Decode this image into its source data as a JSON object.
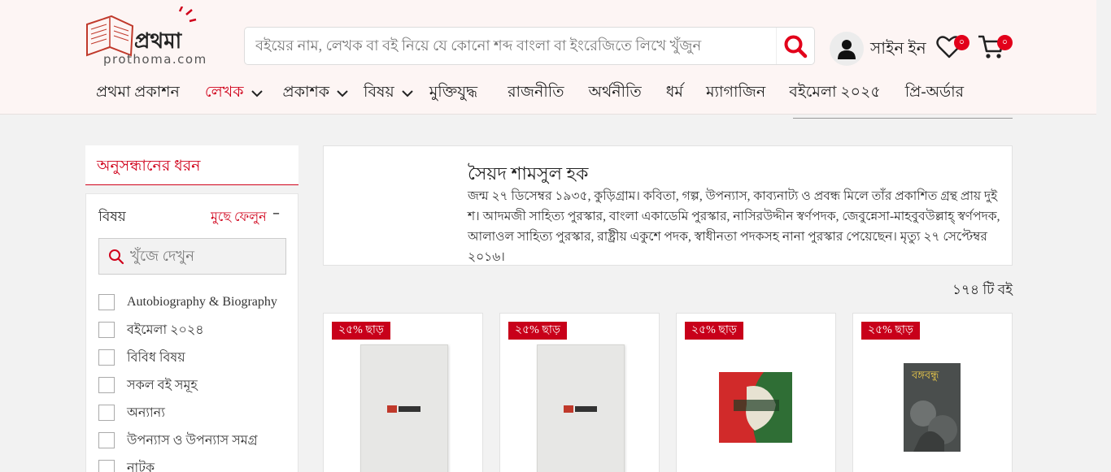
{
  "header": {
    "logo_text": "প্রথমা",
    "logo_sub": "prothoma.com",
    "search_placeholder": "বইয়ের নাম, লেখক বা বই নিয়ে যে কোনো শব্দ বাংলা বা ইংরেজিতে লিখে খুঁজুন",
    "signin_label": "সাইন ইন",
    "wishlist_count": "০",
    "cart_count": "০"
  },
  "nav": {
    "items": [
      {
        "label": "প্রথমা প্রকাশন"
      },
      {
        "label": "লেখক",
        "active": true,
        "dropdown": true
      },
      {
        "label": "প্রকাশক",
        "dropdown": true
      },
      {
        "label": "বিষয়",
        "dropdown": true
      },
      {
        "label": "মুক্তিযুদ্ধ"
      },
      {
        "label": "রাজনীতি"
      },
      {
        "label": "অর্থনীতি"
      },
      {
        "label": "ধর্ম"
      },
      {
        "label": "ম্যাগাজিন"
      },
      {
        "label": "বইমেলা ২০২৫"
      },
      {
        "label": "প্রি-অর্ডার"
      }
    ]
  },
  "sidebar": {
    "title": "অনুসন্ধানের ধরন",
    "filter_heading": "বিষয়",
    "clear_label": "মুছে ফেলুন",
    "collapse_symbol": "–",
    "search_placeholder": "খুঁজে দেখুন",
    "categories": [
      "Autobiography & Biography",
      "বইমেলা ২০২৪",
      "বিবিধ বিষয়",
      "সকল বই সমূহ",
      "অন্যান্য",
      "উপন্যাস ও উপন্যাস সমগ্র",
      "নাটক"
    ]
  },
  "author": {
    "name": "সৈয়দ শামসুল হক",
    "bio": "জন্ম ২৭ ডিসেম্বর ১৯৩৫, কুড়িগ্রাম। কবিতা, গল্প, উপন্যাস, কাব্যনাট্য ও প্রবন্ধ মিলে তাঁর প্রকাশিত গ্রন্থ প্রায় দুই শ। আদমজী সাহিত্য পুরস্কার, বাংলা একাডেমি পুরস্কার, নাসিরউদ্দীন স্বর্ণপদক, জেবুন্নেসা-মাহবুবউল্লাহ্ স্বর্ণপদক, আলাওল সাহিত্য পুরস্কার, রাষ্ট্রীয় একুশে পদক, স্বাধীনতা পদকসহ নানা পুরস্কার পেয়েছেন। মৃত্যু ২৭ সেপ্টেম্বর ২০১৬।"
  },
  "results": {
    "count_label": "১৭৪ টি বই"
  },
  "products": [
    {
      "discount": "২৫% ছাড়",
      "cover": "plain"
    },
    {
      "discount": "২৫% ছাড়",
      "cover": "plain"
    },
    {
      "discount": "২৫% ছাড়",
      "cover": "green"
    },
    {
      "discount": "২৫% ছাড়",
      "cover": "dark",
      "cover_title": "বঙ্গবন্ধু"
    }
  ],
  "colors": {
    "accent": "#d0021b",
    "header_bg": "#fdf5f4",
    "page_bg": "#f2f2f2",
    "badge": "#e2001a"
  }
}
